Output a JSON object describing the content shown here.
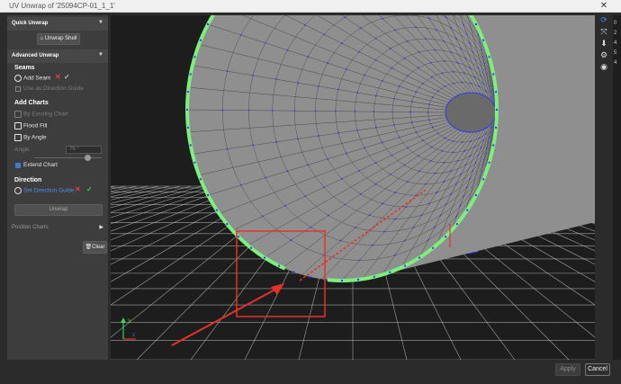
{
  "window": {
    "title": "UV Unwrap of '25094CP-01_1_1'",
    "close_glyph": "✕"
  },
  "panel": {
    "quick_unwrap": {
      "label": "Quick Unwrap",
      "button": "Unwrap Shell"
    },
    "advanced_unwrap": {
      "label": "Advanced Unwrap"
    },
    "seams": {
      "heading": "Seams",
      "add_seam": "Add Seam",
      "use_as_direction_guide": "Use as Direction Guide"
    },
    "add_charts": {
      "heading": "Add Charts",
      "by_existing_chart": "By Existing Chart",
      "flood_fill": "Flood Fill",
      "by_angle": "By Angle",
      "angle_label": "Angle",
      "angle_value": "75 °",
      "angle_level_fraction": 0.75
    },
    "extend_chart": {
      "label": "Extend Chart",
      "checked": true
    },
    "direction": {
      "heading": "Direction",
      "set_direction_guide": "Set Direction Guide"
    },
    "unwrap_button": "Unwrap",
    "position_charts": {
      "label": "Position Charts"
    },
    "clear_button": "Clear"
  },
  "right_toolbar": {
    "icons": [
      "refresh-icon",
      "expand-icon",
      "download-icon",
      "settings-icon",
      "eye-icon"
    ],
    "glyphs": [
      "⟳",
      "⤧",
      "⬇",
      "⚙",
      "◉"
    ],
    "accent": "#3a8cf0"
  },
  "right_strip": {
    "values": [
      "0",
      "2",
      "4",
      "5",
      "4"
    ]
  },
  "footer": {
    "apply": "Apply",
    "cancel": "Cancel"
  },
  "colors": {
    "panel_bg": "#3d3d3d",
    "viewport_bg": "#1d1d1d",
    "seam_green": "#7cf07c",
    "edge_blue": "#3535ff",
    "mesh_gray": "#8f8f8f",
    "annotation_red": "#e8302a",
    "link_blue": "#4a8ff0"
  }
}
